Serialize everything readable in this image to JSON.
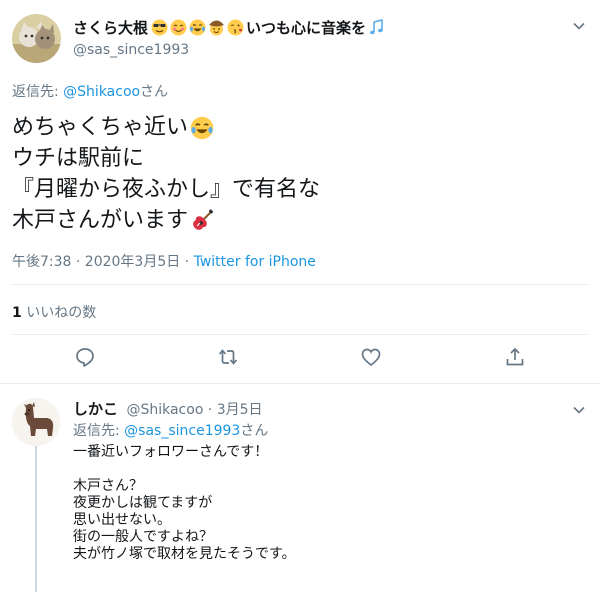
{
  "main_tweet": {
    "display_name": "さくら大根",
    "display_name_suffix": "いつも心に音楽を",
    "name_emojis": [
      "smiling-face-with-sunglasses-icon",
      "smiling-face-with-blush-icon",
      "face-with-tears-of-joy-icon",
      "cowboy-hat-face-icon",
      "face-blowing-kiss-icon"
    ],
    "name_trailing_emoji": "musical-notes-icon",
    "handle": "@sas_since1993",
    "reply_to_label": "返信先: ",
    "reply_to_mention": "@Shikacoo",
    "reply_to_suffix": "さん",
    "text_lines": [
      "めちゃくちゃ近い",
      "ウチは駅前に",
      "『月曜から夜ふかし』で有名な",
      "木戸さんがいます"
    ],
    "timestamp": "午後7:38 · 2020年3月5日 · ",
    "source": "Twitter for iPhone",
    "like_count": "1",
    "like_label": " いいねの数"
  },
  "reply_tweet": {
    "display_name": "しかこ",
    "handle": "@Shikacoo",
    "date": " · 3月5日",
    "reply_to_label": "返信先: ",
    "reply_to_mention": "@sas_since1993",
    "reply_to_suffix": "さん",
    "text_lines": [
      "一番近いフォロワーさんです！",
      "",
      "木戸さん？",
      "夜更かしは観てますが",
      "思い出せない。",
      "街の一般人ですよね？",
      "夫が竹ノ塚で取材を見たそうです。"
    ]
  },
  "colors": {
    "link": "#1b95e0",
    "secondary_text": "#657786",
    "primary_text": "#14171a",
    "divider": "#e6ecf0"
  }
}
